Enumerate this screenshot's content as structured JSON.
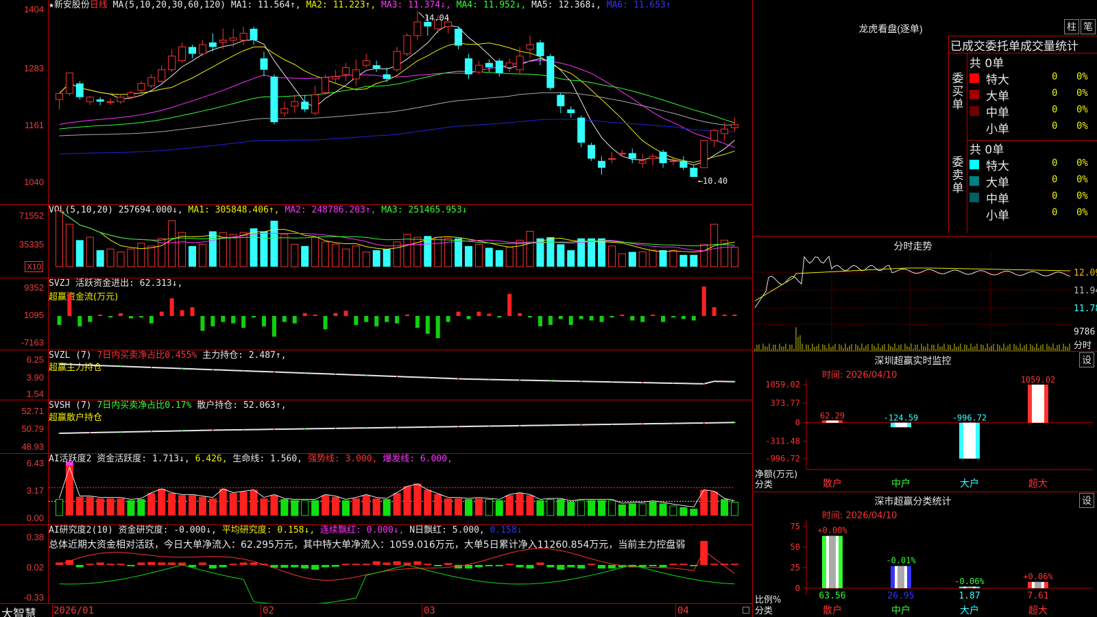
{
  "stock": {
    "name": "★新安股份",
    "period": "日线",
    "ma_label": "MA(5,10,20,30,60,120)",
    "ma": [
      {
        "t": "MA1: 11.564↑,",
        "c": "#e8e8e8"
      },
      {
        "t": "MA2: 11.223↑,",
        "c": "#f0f000"
      },
      {
        "t": "MA3: 11.374↓,",
        "c": "#ff33ff"
      },
      {
        "t": "MA4: 11.952↓,",
        "c": "#33ff33"
      },
      {
        "t": "MA5: 12.368↓,",
        "c": "#e8e8e8"
      },
      {
        "t": "MA6: 11.653↑",
        "c": "#3333ff"
      }
    ],
    "high_label": "14.04",
    "low_label": "←10.40"
  },
  "axes": {
    "price": [
      "1404",
      "1283",
      "1161",
      "1040"
    ],
    "vol": [
      "71552",
      "35335",
      "X10"
    ],
    "svzj": [
      "9352",
      "1095",
      "-7163"
    ],
    "svzl": [
      "6.25",
      "3.90",
      "1.54"
    ],
    "svsh": [
      "52.71",
      "50.79",
      "48.93"
    ],
    "ai1": [
      "6.43",
      "3.17",
      "0.00"
    ],
    "ai2": [
      "0.38",
      "0.02",
      "-0.33"
    ]
  },
  "vol_header": [
    {
      "t": "VOL(5,10,20)",
      "c": "#e8e8e8"
    },
    {
      "t": " 257694.000↓,",
      "c": "#e8e8e8"
    },
    {
      "t": " MA1: 305848.406↑,",
      "c": "#f0f000"
    },
    {
      "t": " MA2: 248786.203↑,",
      "c": "#ff33ff"
    },
    {
      "t": " MA3: 251465.953↓",
      "c": "#33ff33"
    }
  ],
  "svzj_header": [
    {
      "t": "SVZJ  活跃资金进出: 62.313↓,",
      "c": "#e8e8e8"
    }
  ],
  "svzj_sub": "超赢资金流(万元)",
  "svzl_header": [
    {
      "t": "SVZL (7) ",
      "c": "#e8e8e8"
    },
    {
      "t": "7日内买卖净占比0.455%",
      "c": "#ff3333"
    },
    {
      "t": " 主力持仓: 2.487↑,",
      "c": "#e8e8e8"
    }
  ],
  "svzl_sub": "超赢主力持仓",
  "svsh_header": [
    {
      "t": "SVSH (7) ",
      "c": "#e8e8e8"
    },
    {
      "t": "7日内买卖净占比0.17%",
      "c": "#33ff33"
    },
    {
      "t": " 散户持仓: 52.063↑,",
      "c": "#e8e8e8"
    }
  ],
  "svsh_sub": "超赢散户持仓",
  "ai1_header": [
    {
      "t": "AI活跃度2 资金活跃度: 1.713↓,",
      "c": "#e8e8e8"
    },
    {
      "t": " 6.426,",
      "c": "#f0f000"
    },
    {
      "t": " 生命线: 1.560,",
      "c": "#e8e8e8"
    },
    {
      "t": " 强势线: 3.000,",
      "c": "#ff3333"
    },
    {
      "t": " 爆发线: 6.000,",
      "c": "#ff33ff"
    }
  ],
  "ai2_header": [
    {
      "t": "AI研究度2(10) 资金研究度: -0.000↓,",
      "c": "#e8e8e8"
    },
    {
      "t": " 平均研究度: 0.158↓,",
      "c": "#f0f000"
    },
    {
      "t": " 连续飘红: 0.000↓,",
      "c": "#ff33ff"
    },
    {
      "t": " N日飘红: 5.000,",
      "c": "#e8e8e8"
    },
    {
      "t": " 0.158↓",
      "c": "#3333ff"
    }
  ],
  "ai2_text": "总体近期大资金相对活跃，今日大单净流入：62.295万元，其中特大单净流入：1059.016万元，大单5日累计净入11260.854万元，当前主力控盘弱",
  "bottom": {
    "logo": "大智慧",
    "dates": [
      "2026/01",
      "02",
      "03",
      "04"
    ]
  },
  "lhb": {
    "title": "龙虎看盘(逐单)",
    "btn1": "柱",
    "btn2": "笔",
    "subtitle": "已成交委托单成交量统计",
    "buy_label": "委买单",
    "sell_label": "委卖单",
    "buy": {
      "total": "共 0单",
      "rows": [
        {
          "name": "特大",
          "v": "0",
          "p": "0%",
          "color": "#ff0000"
        },
        {
          "name": "大单",
          "v": "0",
          "p": "0%",
          "color": "#a00000"
        },
        {
          "name": "中单",
          "v": "0",
          "p": "0%",
          "color": "#700000"
        },
        {
          "name": "小单",
          "v": "0",
          "p": "0%",
          "color": ""
        }
      ]
    },
    "sell": {
      "total": "共 0单",
      "rows": [
        {
          "name": "特大",
          "v": "0",
          "p": "0%",
          "color": "#00ffff"
        },
        {
          "name": "大单",
          "v": "0",
          "p": "0%",
          "color": "#008080"
        },
        {
          "name": "中单",
          "v": "0",
          "p": "0%",
          "color": "#006060"
        },
        {
          "name": "小单",
          "v": "0",
          "p": "0%",
          "color": ""
        }
      ]
    }
  },
  "intraday": {
    "title": "分时走势",
    "prices": [
      "12.09",
      "11.94",
      "11.78"
    ],
    "vol": "9786",
    "vol_unit": "分时"
  },
  "sz_monitor": {
    "title": "深圳超赢实时监控",
    "btn": "设",
    "time": "时间: 2026/04/10",
    "yticks": [
      "1059.02",
      "373.77",
      "0",
      "-311.48",
      "-996.72"
    ],
    "unit": "净额(万元)",
    "cat_label": "分类",
    "bars": [
      {
        "cat": "散户",
        "value": 62.29,
        "label": "62.29"
      },
      {
        "cat": "中户",
        "value": -124.59,
        "label": "-124.59"
      },
      {
        "cat": "大户",
        "value": -996.72,
        "label": "-996.72"
      },
      {
        "cat": "超大",
        "value": 1059.02,
        "label": "1059.02"
      }
    ]
  },
  "sz_class": {
    "title": "深市超赢分类统计",
    "btn": "设",
    "time": "时间: 2026/04/10",
    "yticks": [
      "75",
      "50",
      "25",
      "0"
    ],
    "unit": "比例%",
    "cat_label": "分类",
    "bars": [
      {
        "cat": "散户",
        "value": 63.56,
        "label": "63.56",
        "chg": "+0.00%"
      },
      {
        "cat": "中户",
        "value": 26.95,
        "label": "26.95",
        "chg": "-0.01%"
      },
      {
        "cat": "大户",
        "value": 1.87,
        "label": "1.87",
        "chg": "-0.06%"
      },
      {
        "cat": "超大",
        "value": 7.61,
        "label": "7.61",
        "chg": "+0.06%"
      }
    ]
  },
  "chart_data": {
    "type": "candlestick",
    "candles": [
      [
        12.1,
        12.23,
        11.88,
        12.23
      ],
      [
        12.23,
        12.68,
        12.18,
        12.45
      ],
      [
        12.45,
        12.15,
        12.1,
        12.5
      ],
      [
        12.05,
        12.15,
        11.98,
        12.18
      ],
      [
        12.1,
        12.05,
        11.97,
        12.15
      ],
      [
        12.05,
        12.05,
        11.98,
        12.12
      ],
      [
        12.05,
        12.15,
        12.0,
        12.2
      ],
      [
        12.15,
        12.25,
        12.1,
        12.3
      ],
      [
        12.3,
        12.45,
        12.25,
        12.5
      ],
      [
        12.4,
        12.58,
        12.35,
        12.65
      ],
      [
        12.5,
        12.75,
        12.45,
        12.85
      ],
      [
        12.75,
        13.05,
        12.7,
        13.2
      ],
      [
        12.95,
        13.25,
        12.9,
        13.35
      ],
      [
        13.25,
        13.1,
        13.0,
        13.3
      ],
      [
        13.1,
        13.3,
        13.05,
        13.4
      ],
      [
        13.35,
        13.25,
        13.15,
        13.55
      ],
      [
        13.35,
        13.4,
        13.2,
        13.65
      ],
      [
        13.4,
        13.45,
        13.25,
        13.65
      ],
      [
        13.4,
        13.55,
        13.3,
        13.7
      ],
      [
        13.65,
        13.4,
        13.3,
        13.7
      ],
      [
        13.0,
        12.75,
        12.6,
        13.15
      ],
      [
        12.6,
        11.6,
        11.55,
        12.65
      ],
      [
        11.8,
        11.9,
        11.72,
        12.05
      ],
      [
        11.95,
        12.05,
        11.8,
        12.2
      ],
      [
        12.05,
        11.88,
        11.82,
        12.2
      ],
      [
        11.8,
        12.2,
        11.75,
        12.4
      ],
      [
        12.25,
        12.58,
        12.2,
        12.65
      ],
      [
        12.55,
        12.6,
        12.45,
        12.75
      ],
      [
        12.65,
        12.8,
        12.5,
        12.9
      ],
      [
        12.55,
        12.75,
        12.4,
        12.98
      ],
      [
        12.85,
        12.95,
        12.8,
        13.1
      ],
      [
        12.85,
        12.78,
        12.7,
        12.95
      ],
      [
        12.65,
        12.55,
        12.48,
        12.8
      ],
      [
        12.75,
        13.15,
        12.7,
        13.25
      ],
      [
        13.1,
        13.5,
        13.05,
        13.55
      ],
      [
        13.5,
        13.8,
        13.4,
        14.04
      ],
      [
        13.8,
        13.7,
        13.5,
        13.95
      ],
      [
        13.65,
        13.85,
        13.55,
        13.95
      ],
      [
        13.7,
        13.8,
        13.55,
        13.9
      ],
      [
        13.65,
        13.28,
        13.2,
        13.7
      ],
      [
        13.0,
        12.65,
        12.55,
        13.1
      ],
      [
        12.7,
        12.85,
        12.65,
        12.95
      ],
      [
        12.9,
        12.8,
        12.7,
        12.98
      ],
      [
        12.95,
        12.68,
        12.6,
        13.0
      ],
      [
        12.8,
        12.9,
        12.7,
        13.0
      ],
      [
        12.75,
        13.05,
        12.65,
        13.25
      ],
      [
        13.2,
        13.3,
        13.0,
        13.5
      ],
      [
        13.35,
        13.05,
        12.85,
        13.4
      ],
      [
        13.05,
        12.35,
        12.3,
        13.1
      ],
      [
        12.2,
        11.95,
        11.8,
        12.25
      ],
      [
        11.88,
        11.8,
        11.7,
        11.95
      ],
      [
        11.7,
        11.15,
        11.05,
        11.75
      ],
      [
        11.1,
        10.8,
        10.75,
        11.15
      ],
      [
        10.75,
        10.6,
        10.45,
        10.85
      ],
      [
        10.8,
        10.8,
        10.7,
        10.95
      ],
      [
        10.9,
        10.92,
        10.85,
        11.0
      ],
      [
        10.92,
        10.8,
        10.7,
        11.02
      ],
      [
        10.7,
        10.75,
        10.6,
        10.9
      ],
      [
        10.8,
        10.85,
        10.65,
        10.9
      ],
      [
        10.95,
        10.7,
        10.6,
        11.0
      ],
      [
        10.75,
        10.75,
        10.65,
        10.85
      ],
      [
        10.75,
        10.6,
        10.55,
        10.85
      ],
      [
        10.6,
        10.4,
        10.4,
        10.65
      ],
      [
        10.6,
        11.2,
        10.6,
        11.2
      ],
      [
        11.2,
        11.42,
        11.05,
        11.45
      ],
      [
        11.35,
        11.45,
        11.2,
        11.6
      ],
      [
        11.48,
        11.55,
        11.4,
        11.7
      ]
    ],
    "ylim": [
      10.4,
      14.04
    ],
    "x_ticks": [
      "2026/01",
      "02",
      "03",
      "04"
    ],
    "ma_series": [
      "MA1",
      "MA2",
      "MA3",
      "MA4",
      "MA5",
      "MA6"
    ]
  }
}
